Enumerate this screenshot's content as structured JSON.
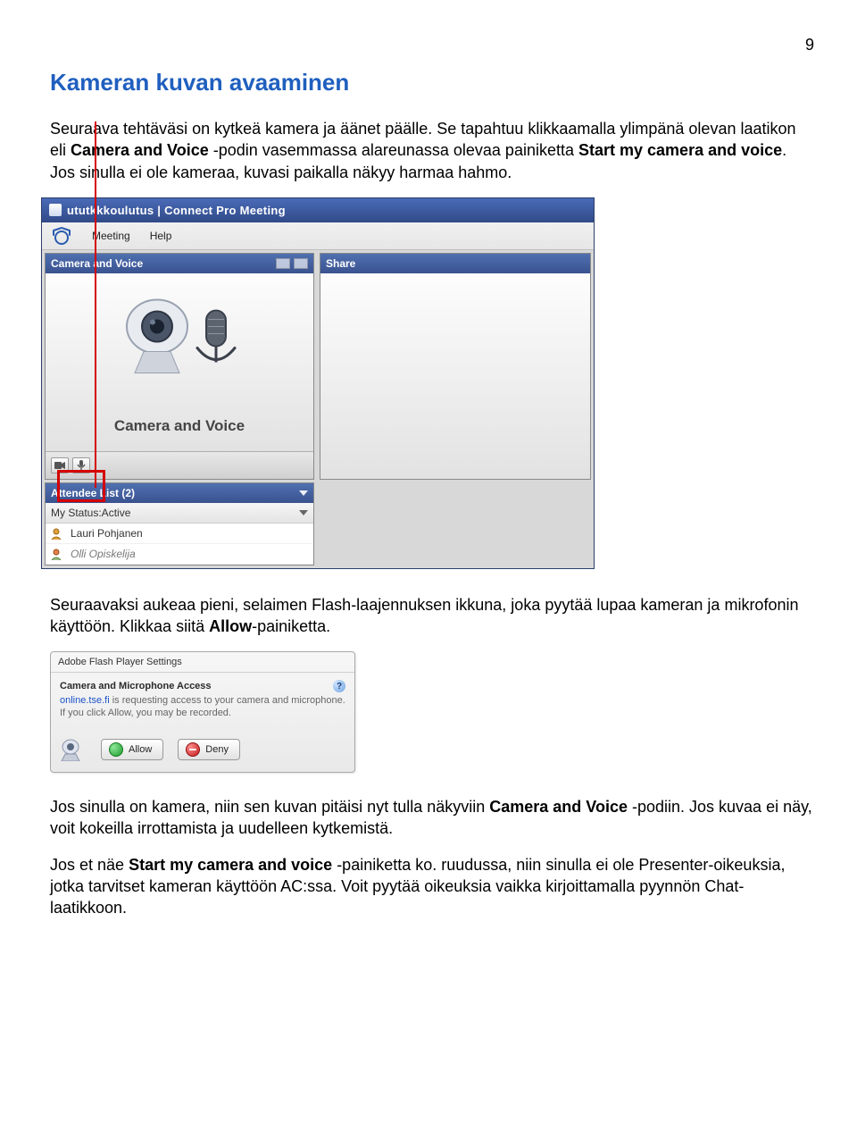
{
  "page_number": "9",
  "heading": "Kameran kuvan avaaminen",
  "intro_before_bold1": "Seuraava tehtäväsi on kytkeä kamera ja äänet päälle. Se tapahtuu klikkaamalla ylimpänä olevan laatikon eli ",
  "intro_bold1": "Camera and Voice",
  "intro_mid": " -podin vasemmassa alareunassa olevaa painiketta ",
  "intro_bold2": "Start my camera and voice",
  "intro_after_bold2": ". Jos sinulla ei ole kameraa, kuvasi paikalla näkyy harmaa hahmo.",
  "app": {
    "title": "ututkkkoulutus | Connect Pro Meeting",
    "menu": {
      "meeting": "Meeting",
      "help": "Help"
    },
    "camera_pod_title": "Camera and Voice",
    "camera_pod_caption": "Camera and Voice",
    "share_pod_title": "Share",
    "attendee": {
      "title": "Attendee List (2)",
      "status": "My Status:Active",
      "items": [
        "Lauri Pohjanen",
        "Olli Opiskelija"
      ]
    }
  },
  "mid_before_bold": "Seuraavaksi aukeaa pieni, selaimen Flash-laajennuksen ikkuna, joka pyytää lupaa kameran ja mikrofonin käyttöön. Klikkaa siitä ",
  "mid_bold": "Allow",
  "mid_after_bold": "-painiketta.",
  "flash": {
    "title": "Adobe Flash Player Settings",
    "subtitle": "Camera and Microphone Access",
    "body_link": "online.tse.fi",
    "body_text": " is requesting access to your camera and microphone. If you click Allow, you may be recorded.",
    "allow": "Allow",
    "deny": "Deny"
  },
  "end1_before_bold": "Jos sinulla on kamera, niin sen kuvan pitäisi nyt tulla näkyviin ",
  "end1_bold": "Camera and Voice",
  "end1_after_bold": " -podiin. Jos kuvaa ei näy, voit kokeilla irrottamista ja uudelleen kytkemistä.",
  "end2_before_bold": "Jos et näe ",
  "end2_bold": "Start my camera and voice",
  "end2_after_bold": " -painiketta ko. ruudussa, niin sinulla ei ole Presenter-oikeuksia, jotka tarvitset kameran käyttöön AC:ssa. Voit pyytää oikeuksia vaikka kirjoittamalla pyynnön Chat-laatikkoon."
}
